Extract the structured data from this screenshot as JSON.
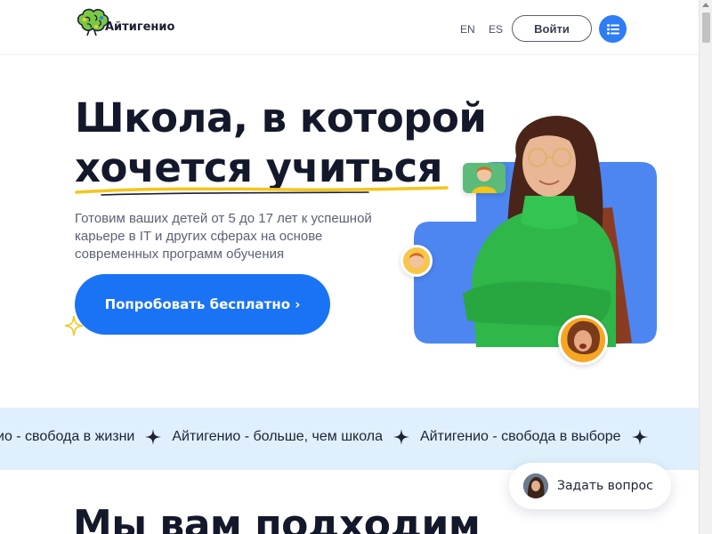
{
  "header": {
    "logo_text": "Айтигенио",
    "lang_en": "EN",
    "lang_es": "ES",
    "login_label": "Войти",
    "menu_icon": "list-icon"
  },
  "hero": {
    "title_line1": "Школа, в которой",
    "title_line2": "хочется учиться",
    "description": "Готовим ваших детей от 5 до 17 лет к успешной карьере в IT и других сферах на основе современных программ обучения",
    "cta_label": "Попробовать бесплатно ›"
  },
  "marquee": {
    "items": [
      "ио - свобода в жизни",
      "Айтигенио - больше, чем школа",
      "Айтигенио - свобода в выборе"
    ]
  },
  "chat": {
    "label": "Задать вопрос"
  },
  "section": {
    "title": "Мы вам подходим"
  },
  "colors": {
    "brand_blue": "#1a73f5",
    "hero_shape": "#4d86f0",
    "marquee_bg": "#dff0fc",
    "underline_yellow": "#f5c518",
    "dark_text": "#14182b"
  }
}
